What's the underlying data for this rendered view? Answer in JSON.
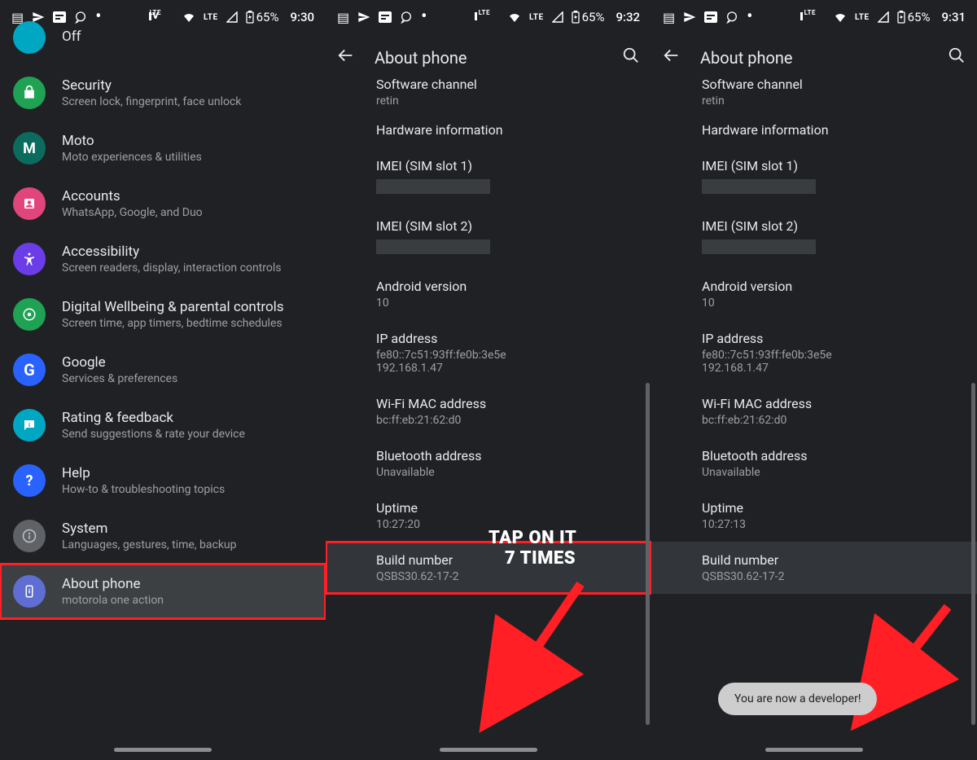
{
  "status": {
    "battery": "65%",
    "times": [
      "9:30",
      "9:32",
      "9:31"
    ]
  },
  "screen1": {
    "items": [
      {
        "title": "Off",
        "sub": ""
      },
      {
        "title": "Security",
        "sub": "Screen lock, fingerprint, face unlock",
        "icon": "#1fa254"
      },
      {
        "title": "Moto",
        "sub": "Moto experiences & utilities",
        "icon": "#0b6b5c"
      },
      {
        "title": "Accounts",
        "sub": "WhatsApp, Google, and Duo",
        "icon": "#e0457b"
      },
      {
        "title": "Accessibility",
        "sub": "Screen readers, display, interaction controls",
        "icon": "#6a3de8"
      },
      {
        "title": "Digital Wellbeing & parental controls",
        "sub": "Screen time, app timers, bedtime schedules",
        "icon": "#1fa254"
      },
      {
        "title": "Google",
        "sub": "Services & preferences",
        "icon": "#2962ff"
      },
      {
        "title": "Rating & feedback",
        "sub": "Send suggestions & rate your device",
        "icon": "#00a7c2"
      },
      {
        "title": "Help",
        "sub": "How-to & troubleshooting topics",
        "icon": "#2962ff"
      },
      {
        "title": "System",
        "sub": "Languages, gestures, time, backup",
        "icon": "#5f6368"
      },
      {
        "title": "About phone",
        "sub": "motorola one action",
        "icon": "#5f6ed2"
      }
    ]
  },
  "appbar_title": "About phone",
  "about": {
    "software_channel": {
      "label": "Software channel",
      "value": "retin"
    },
    "hw_info": "Hardware information",
    "imei1": "IMEI (SIM slot 1)",
    "imei2": "IMEI (SIM slot 2)",
    "android": {
      "label": "Android version",
      "value": "10"
    },
    "ip": {
      "label": "IP address",
      "value1": "fe80::7c51:93ff:fe0b:3e5e",
      "value2": "192.168.1.47"
    },
    "wifi": {
      "label": "Wi-Fi MAC address",
      "value": "bc:ff:eb:21:62:d0"
    },
    "bt": {
      "label": "Bluetooth address",
      "value": "Unavailable"
    },
    "uptime": {
      "label": "Uptime",
      "value_a": "10:27:20",
      "value_b": "10:27:13"
    },
    "build": {
      "label": "Build number",
      "value": "QSBS30.62-17-2"
    }
  },
  "annotation": {
    "line1": "TAP ON IT",
    "line2": "7 TIMES"
  },
  "toast": "You are now a developer!"
}
